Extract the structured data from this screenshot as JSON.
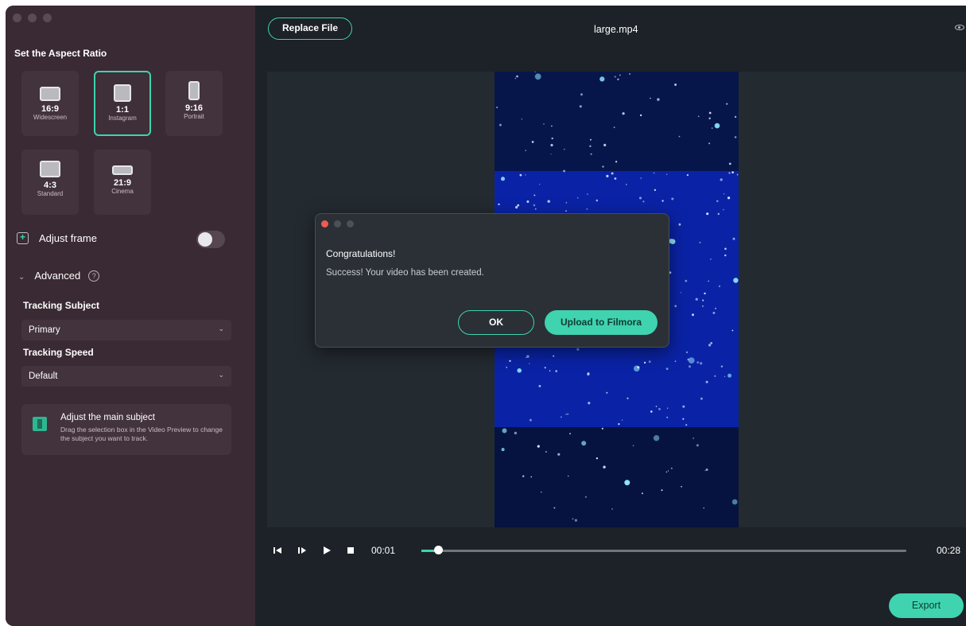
{
  "sidebar": {
    "title": "Set the Aspect Ratio",
    "ratios": [
      {
        "value": "16:9",
        "name": "Widescreen"
      },
      {
        "value": "1:1",
        "name": "Instagram"
      },
      {
        "value": "9:16",
        "name": "Portrait"
      },
      {
        "value": "4:3",
        "name": "Standard"
      },
      {
        "value": "21:9",
        "name": "Cinema"
      }
    ],
    "selected_ratio": "1:1",
    "adjust_frame_label": "Adjust frame",
    "adjust_frame_enabled": false,
    "advanced_label": "Advanced",
    "tracking_subject_label": "Tracking Subject",
    "tracking_subject_value": "Primary",
    "tracking_speed_label": "Tracking Speed",
    "tracking_speed_value": "Default",
    "hint_title": "Adjust the main subject",
    "hint_desc": "Drag the selection box in the Video Preview to change the subject you want to track."
  },
  "header": {
    "replace_label": "Replace File",
    "filename": "large.mp4"
  },
  "playback": {
    "current_time": "00:01",
    "end_time": "00:28",
    "progress": 0.035
  },
  "export_label": "Export",
  "dialog": {
    "title": "Congratulations!",
    "message": "Success! Your video has been created.",
    "ok_label": "OK",
    "upload_label": "Upload to Filmora"
  },
  "colors": {
    "accent": "#3fd3b0",
    "sidebar_bg": "#3a2a33",
    "main_bg": "#1c2227",
    "video_bg": "#061442"
  }
}
